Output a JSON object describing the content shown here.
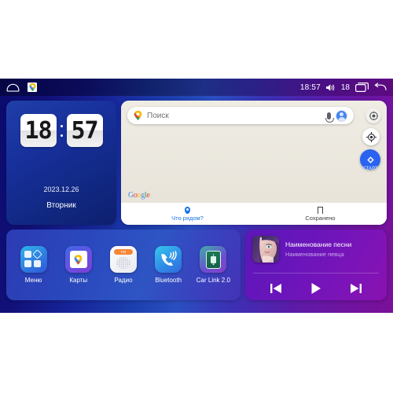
{
  "statusbar": {
    "home_icon": "home-icon",
    "maps_icon": "maps-app-icon",
    "time": "18:57",
    "volume_icon": "volume-icon",
    "volume_level": "18",
    "recents_icon": "recents-icon",
    "back_icon": "back-icon"
  },
  "clock_widget": {
    "hours": "18",
    "minutes": "57",
    "date": "2023.12.26",
    "weekday": "Вторник"
  },
  "maps_widget": {
    "search": {
      "placeholder": "Поиск",
      "value": "",
      "pin_icon": "map-pin-icon",
      "mic_icon": "microphone-icon",
      "avatar_icon": "account-avatar-icon"
    },
    "layers_icon": "layers-icon",
    "gps_icon": "my-location-icon",
    "start_button": {
      "label": "СТАРТ",
      "icon": "navigation-arrow-icon"
    },
    "attribution": "Google",
    "tabs": [
      {
        "label": "Что рядом?",
        "icon": "pin-icon",
        "active": true
      },
      {
        "label": "Сохранено",
        "icon": "bookmark-icon",
        "active": false
      }
    ]
  },
  "apps_widget": {
    "items": [
      {
        "label": "Меню",
        "icon": "grid-menu-icon"
      },
      {
        "label": "Карты",
        "icon": "google-maps-icon"
      },
      {
        "label": "Радио",
        "icon": "radio-icon",
        "band": "FM"
      },
      {
        "label": "Bluetooth",
        "icon": "bluetooth-phone-icon"
      },
      {
        "label": "Car Link 2.0",
        "icon": "car-link-icon"
      }
    ]
  },
  "media_widget": {
    "album_art_icon": "album-art-portrait",
    "title": "Наименование песни",
    "artist": "Наименование певца",
    "controls": [
      {
        "name": "previous",
        "icon": "skip-previous-icon"
      },
      {
        "name": "play",
        "icon": "play-icon"
      },
      {
        "name": "next",
        "icon": "skip-next-icon"
      }
    ]
  },
  "colors": {
    "bg_left": "#0a0a6e",
    "bg_mid": "#2a4fc0",
    "bg_right": "#7a0f99",
    "accent_blue": "#2a63f0",
    "tab_active": "#1a73e8",
    "media_purple": "#6a15bb",
    "radio_orange": "#f58634"
  }
}
